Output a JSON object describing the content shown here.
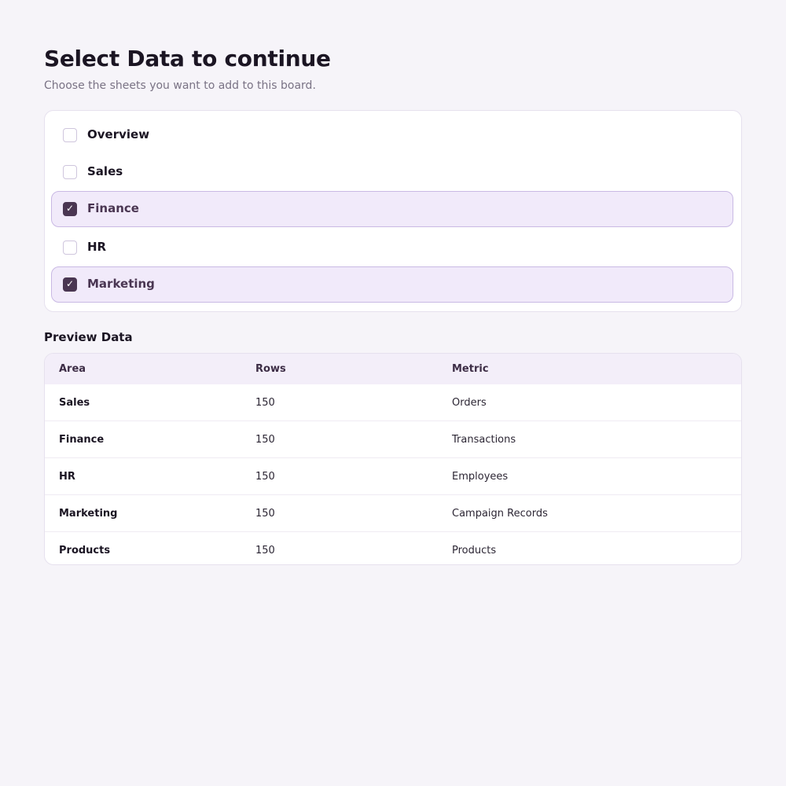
{
  "header": {
    "title": "Select Data to continue",
    "subtitle": "Choose the sheets you want to add to this board."
  },
  "sheets": [
    {
      "label": "Overview",
      "checked": false
    },
    {
      "label": "Sales",
      "checked": false
    },
    {
      "label": "Finance",
      "checked": true
    },
    {
      "label": "HR",
      "checked": false
    },
    {
      "label": "Marketing",
      "checked": true
    }
  ],
  "checkmark": "✓",
  "preview": {
    "title": "Preview Data",
    "columns": [
      "Area",
      "Rows",
      "Metric"
    ],
    "rows": [
      [
        "Sales",
        "150",
        "Orders"
      ],
      [
        "Finance",
        "150",
        "Transactions"
      ],
      [
        "HR",
        "150",
        "Employees"
      ],
      [
        "Marketing",
        "150",
        "Campaign Records"
      ],
      [
        "Products",
        "150",
        "Products"
      ]
    ]
  },
  "colors": {
    "background": "#f6f4f9",
    "accent": "#4a3652",
    "selected_background": "#f1eafa",
    "selected_border": "#c9b9e4"
  }
}
